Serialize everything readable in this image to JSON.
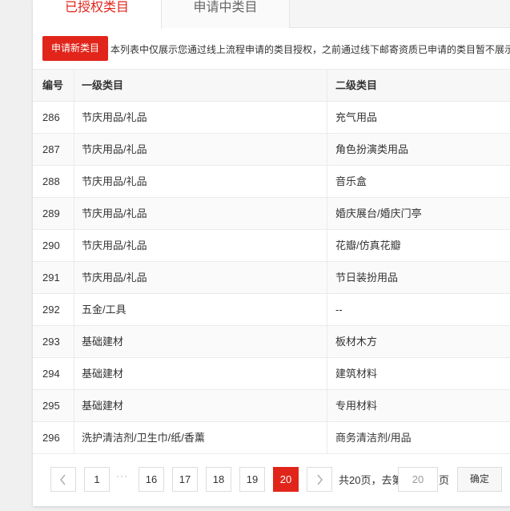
{
  "tabs": {
    "authorized": "已授权类目",
    "applying": "申请中类目"
  },
  "toolbar": {
    "new_button": "申请新类目",
    "notice": "本列表中仅展示您通过线上流程申请的类目授权，之前通过线下邮寄资质已申请的类目暂不展示"
  },
  "table": {
    "headers": [
      "编号",
      "一级类目",
      "二级类目"
    ],
    "rows": [
      {
        "id": "286",
        "level1": "节庆用品/礼品",
        "level2": "充气用品"
      },
      {
        "id": "287",
        "level1": "节庆用品/礼品",
        "level2": "角色扮演类用品"
      },
      {
        "id": "288",
        "level1": "节庆用品/礼品",
        "level2": "音乐盒"
      },
      {
        "id": "289",
        "level1": "节庆用品/礼品",
        "level2": "婚庆展台/婚庆门亭"
      },
      {
        "id": "290",
        "level1": "节庆用品/礼品",
        "level2": "花瓣/仿真花瓣"
      },
      {
        "id": "291",
        "level1": "节庆用品/礼品",
        "level2": "节日装扮用品"
      },
      {
        "id": "292",
        "level1": "五金/工具",
        "level2": "--"
      },
      {
        "id": "293",
        "level1": "基础建材",
        "level2": "板材木方"
      },
      {
        "id": "294",
        "level1": "基础建材",
        "level2": "建筑材料"
      },
      {
        "id": "295",
        "level1": "基础建材",
        "level2": "专用材料"
      },
      {
        "id": "296",
        "level1": "洗护清洁剂/卫生巾/纸/香薰",
        "level2": "商务清洁剂/用品"
      }
    ]
  },
  "pagination": {
    "prev_icon": "chevron-left-icon",
    "next_icon": "chevron-right-icon",
    "first": "1",
    "ellipsis": "···",
    "pages": [
      "16",
      "17",
      "18",
      "19",
      "20"
    ],
    "current": "20",
    "total_text": "共20页，去第",
    "jump_value": "20",
    "page_unit": "页",
    "confirm": "确定"
  },
  "colors": {
    "accent": "#e1251b"
  }
}
